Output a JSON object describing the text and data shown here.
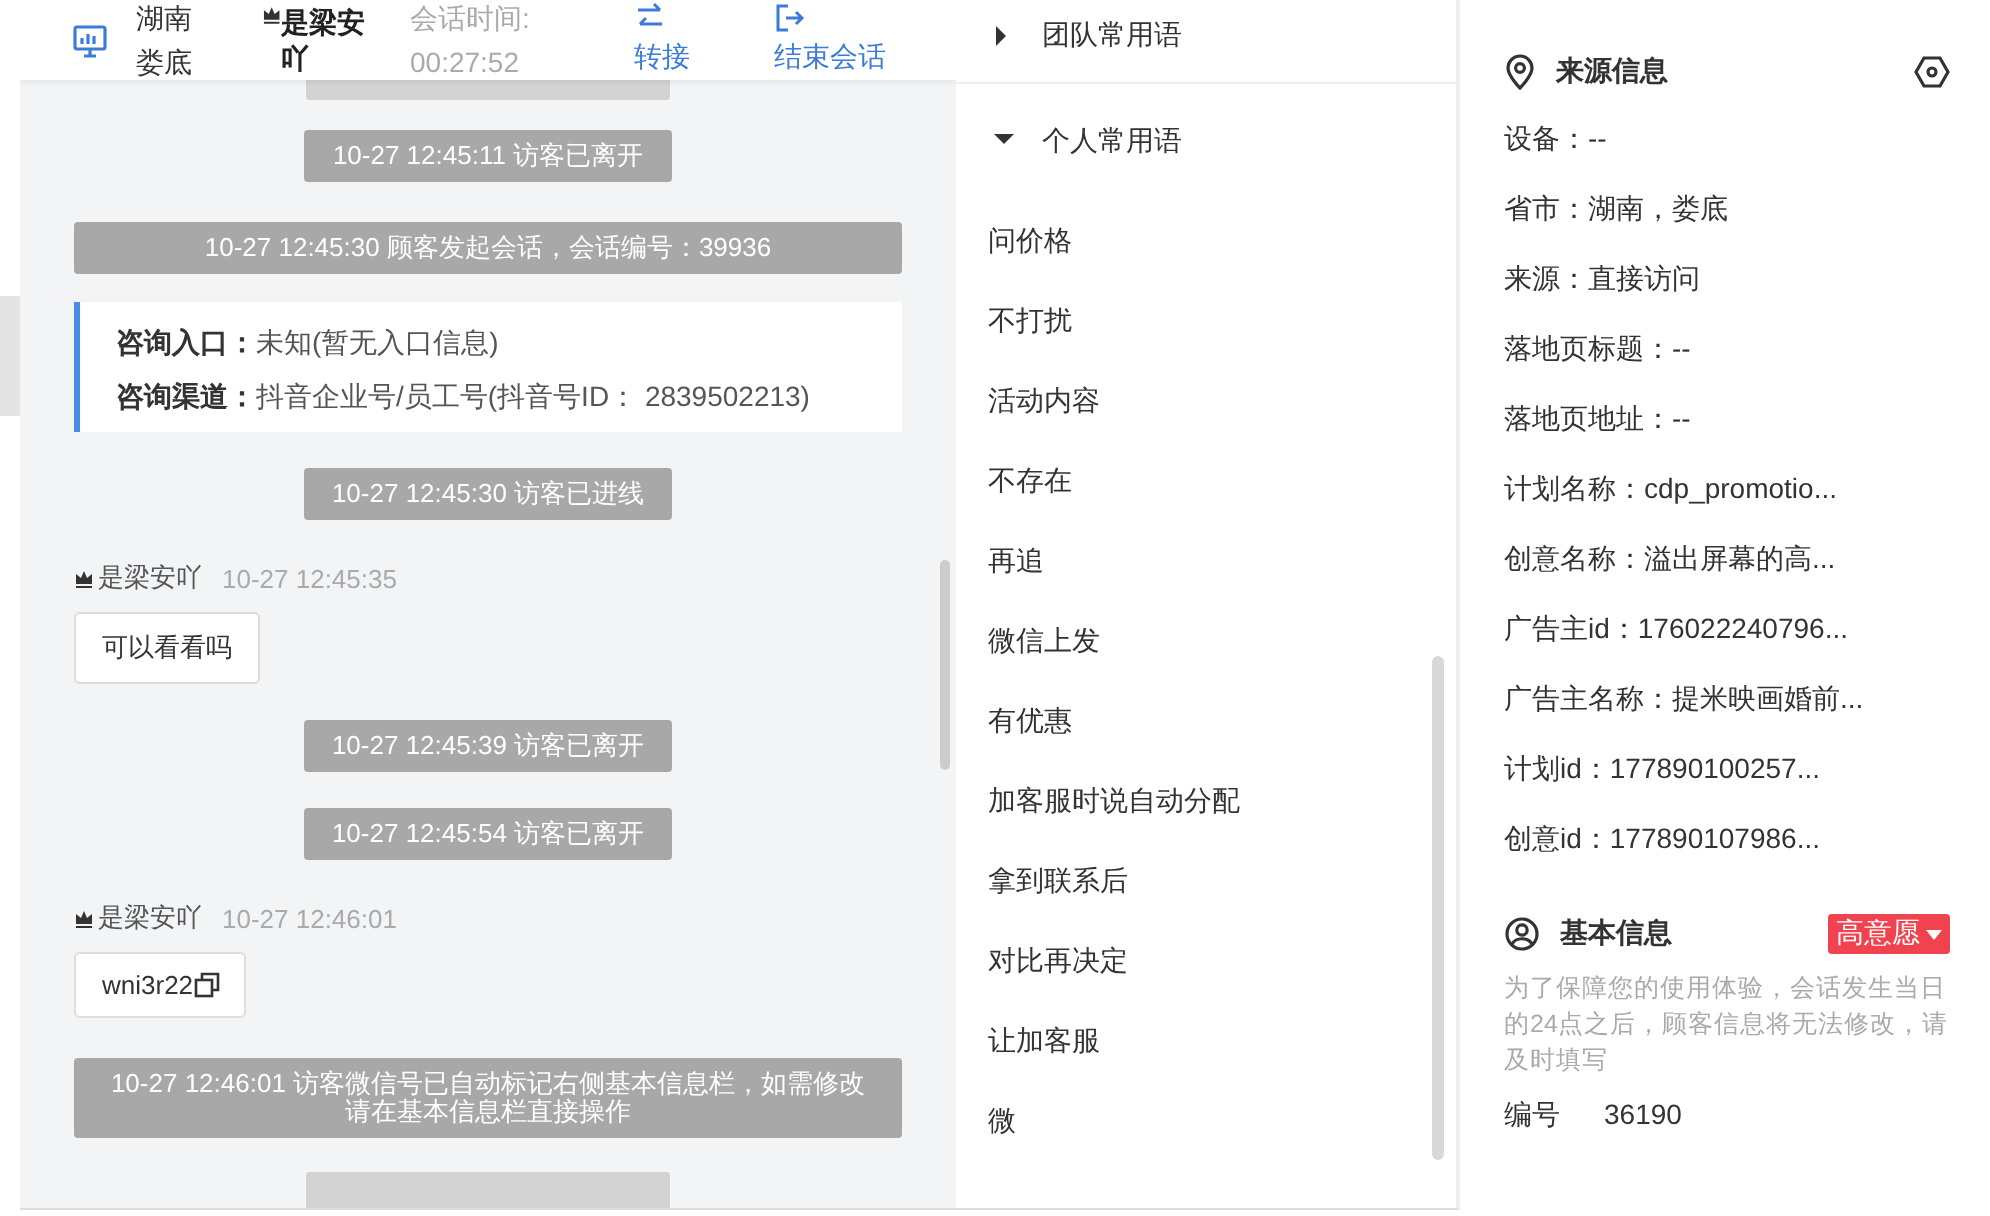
{
  "header": {
    "location": "湖南娄底",
    "agent_name": "是梁安吖",
    "session_time_label": "会话时间:",
    "session_time": "00:27:52",
    "actions": [
      {
        "kind": "transfer",
        "label": "转接"
      },
      {
        "kind": "end",
        "label": "结束会话"
      }
    ]
  },
  "chat": {
    "messages": [
      {
        "kind": "system",
        "text": "10-27 12:45:11 访客已离开"
      },
      {
        "kind": "system",
        "text": "10-27 12:45:30 顾客发起会话，会话编号：39936"
      },
      {
        "kind": "info",
        "rows": [
          {
            "label": "咨询入口：",
            "value": "未知(暂无入口信息)"
          },
          {
            "label": "咨询渠道：",
            "value": "抖音企业号/员工号(抖音号ID： 2839502213)"
          }
        ]
      },
      {
        "kind": "system",
        "text": "10-27 12:45:30 访客已进线"
      },
      {
        "kind": "user",
        "name": "是梁安吖",
        "time": "10-27 12:45:35",
        "text": "可以看看吗",
        "copy": false
      },
      {
        "kind": "system",
        "text": "10-27 12:45:39 访客已离开"
      },
      {
        "kind": "system",
        "text": "10-27 12:45:54 访客已离开"
      },
      {
        "kind": "user",
        "name": "是梁安吖",
        "time": "10-27 12:46:01",
        "text": "wni3r22",
        "copy": true
      },
      {
        "kind": "system",
        "text": "10-27 12:46:01 访客微信号已自动标记右侧基本信息栏，如需修改请在基本信息栏直接操作"
      }
    ]
  },
  "phrases": {
    "groups": [
      {
        "title": "团队常用语",
        "expanded": false
      },
      {
        "title": "个人常用语",
        "expanded": true
      }
    ],
    "items": [
      "问价格",
      "不打扰",
      "活动内容",
      "不存在",
      "再追",
      "微信上发",
      "有优惠",
      "加客服时说自动分配",
      "拿到联系后",
      "对比再决定",
      "让加客服",
      "微"
    ]
  },
  "source_info": {
    "title": "来源信息",
    "fields": [
      "设备：--",
      "省市：湖南，娄底",
      "来源：直接访问",
      "落地页标题：--",
      "落地页地址：--",
      "计划名称：cdp_promotio...",
      "创意名称：溢出屏幕的高...",
      "广告主id：176022240796...",
      "广告主名称：提米映画婚前...",
      "计划id：177890100257...",
      "创意id：177890107986..."
    ]
  },
  "basic_info": {
    "title": "基本信息",
    "tag": "高意愿",
    "note": "为了保障您的使用体验，会话发生当日的24点之后，顾客信息将无法修改，请及时填写",
    "fields": [
      {
        "label": "编号",
        "value": "36190"
      }
    ]
  }
}
